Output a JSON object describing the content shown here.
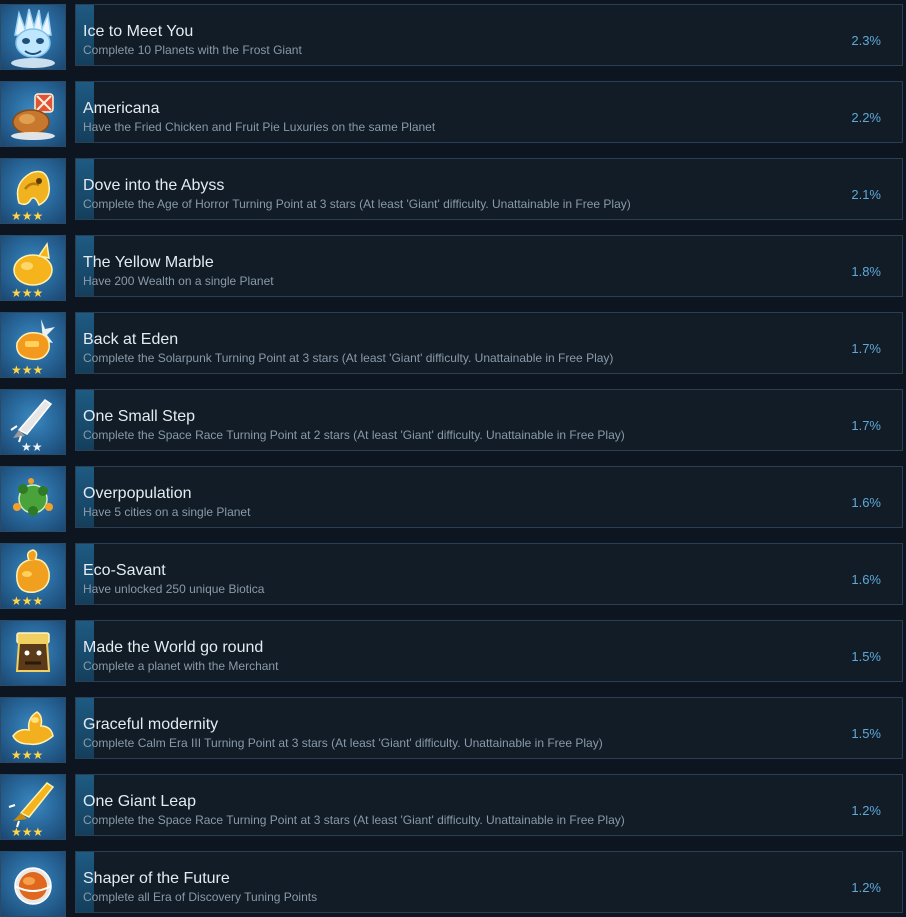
{
  "accent_color": "#5fa8d8",
  "achievements": [
    {
      "title": "Ice to Meet You",
      "description": "Complete 10 Planets with the Frost Giant",
      "percent": "2.3%",
      "icon": "frost-giant-icon",
      "stars": 0
    },
    {
      "title": "Americana",
      "description": "Have the Fried Chicken and Fruit Pie Luxuries on the same Planet",
      "percent": "2.2%",
      "icon": "fried-chicken-icon",
      "stars": 0
    },
    {
      "title": "Dove into the Abyss",
      "description": "Complete the Age of Horror Turning Point at 3 stars (At least 'Giant' difficulty. Unattainable in Free Play)",
      "percent": "2.1%",
      "icon": "abyss-creature-icon",
      "stars": 3
    },
    {
      "title": "The Yellow Marble",
      "description": "Have 200 Wealth on a single Planet",
      "percent": "1.8%",
      "icon": "golden-planet-icon",
      "stars": 3
    },
    {
      "title": "Back at Eden",
      "description": "Complete the Solarpunk Turning Point at 3 stars (At least 'Giant' difficulty. Unattainable in Free Play)",
      "percent": "1.7%",
      "icon": "solarpunk-icon",
      "stars": 3
    },
    {
      "title": "One Small Step",
      "description": "Complete the Space Race Turning Point at 2 stars (At least 'Giant' difficulty. Unattainable in Free Play)",
      "percent": "1.7%",
      "icon": "silver-rocket-icon",
      "stars": 2
    },
    {
      "title": "Overpopulation",
      "description": "Have 5 cities on a single Planet",
      "percent": "1.6%",
      "icon": "crowded-planet-icon",
      "stars": 0
    },
    {
      "title": "Eco-Savant",
      "description": "Have unlocked 250 unique Biotica",
      "percent": "1.6%",
      "icon": "biotica-icon",
      "stars": 3
    },
    {
      "title": "Made the World go round",
      "description": "Complete a planet with the Merchant",
      "percent": "1.5%",
      "icon": "merchant-icon",
      "stars": 0
    },
    {
      "title": "Graceful modernity",
      "description": "Complete Calm Era III Turning Point at 3 stars (At least 'Giant' difficulty. Unattainable in Free Play)",
      "percent": "1.5%",
      "icon": "calm-era-icon",
      "stars": 3
    },
    {
      "title": "One Giant Leap",
      "description": "Complete the Space Race Turning Point at 3 stars (At least 'Giant' difficulty. Unattainable in Free Play)",
      "percent": "1.2%",
      "icon": "golden-rocket-icon",
      "stars": 3
    },
    {
      "title": "Shaper of the Future",
      "description": "Complete all Era of Discovery Tuning Points",
      "percent": "1.2%",
      "icon": "discovery-planet-icon",
      "stars": 0
    }
  ]
}
